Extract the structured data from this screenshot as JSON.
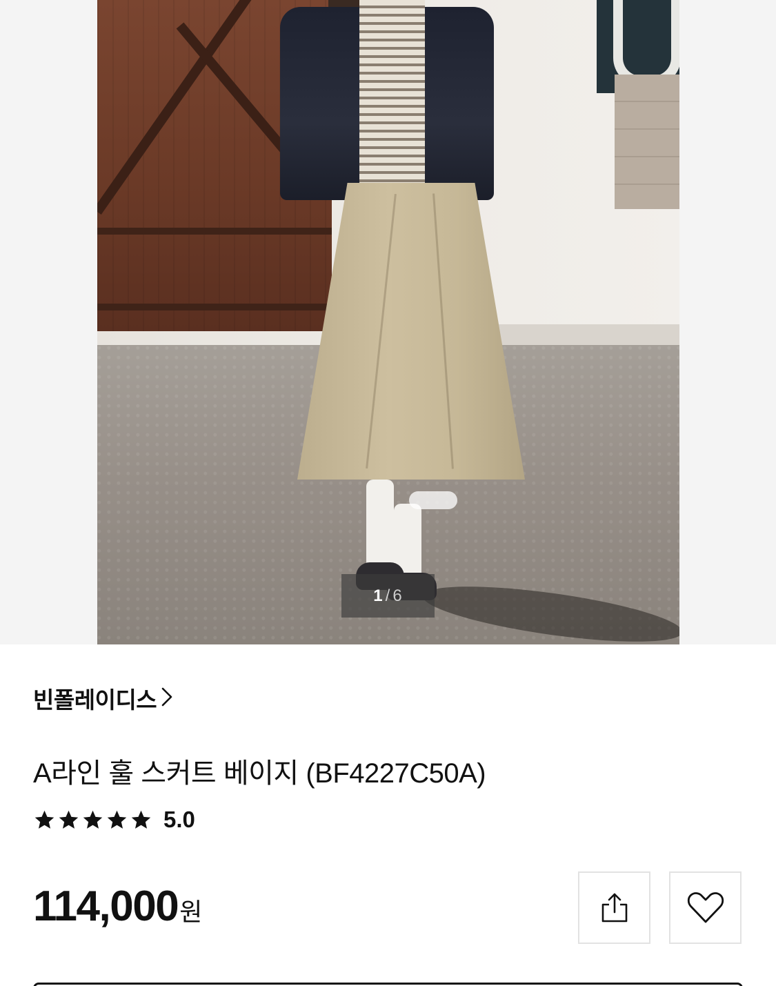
{
  "gallery": {
    "current": "1",
    "separator": "/",
    "total": "6"
  },
  "brand": {
    "name": "빈폴레이디스",
    "chevron_icon": "chevron-right-icon"
  },
  "product": {
    "title": "A라인 훌 스커트 베이지 (BF4227C50A)",
    "rating": {
      "stars": 5,
      "max_stars": 5,
      "value": "5.0"
    },
    "price": {
      "amount": "114,000",
      "unit": "원"
    }
  },
  "actions": {
    "share_icon": "share-icon",
    "wishlist_icon": "heart-icon"
  },
  "colors": {
    "text": "#111111",
    "border": "#e2e2e2",
    "counter_bg": "rgba(60,60,60,0.65)"
  }
}
